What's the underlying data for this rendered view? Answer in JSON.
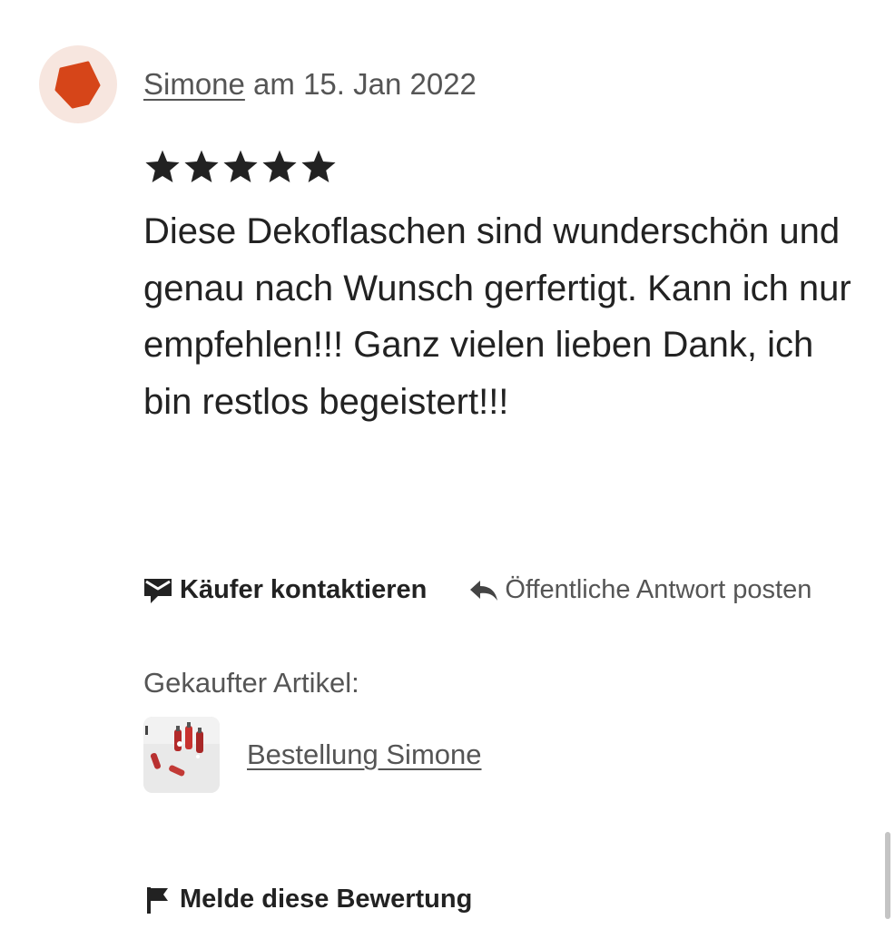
{
  "review": {
    "reviewer_name": "Simone",
    "date_text": " am 15. Jan 2022",
    "rating": 5,
    "rating_max": 5,
    "text": "Diese Dekoflaschen sind wunderschön und genau nach Wunsch gerfertigt. Kann ich nur empfehlen!!! Ganz vielen lieben Dank, ich bin restlos begeistert!!!"
  },
  "actions": {
    "contact_label": "Käufer kontaktieren",
    "reply_label": "Öffentliche Antwort posten",
    "contact_icon": "envelope-icon",
    "reply_icon": "reply-arrow-icon"
  },
  "purchased": {
    "label": "Gekaufter Artikel:",
    "item_link": "Bestellung Simone"
  },
  "report": {
    "label": "Melde diese Bewertung",
    "icon": "flag-icon"
  },
  "colors": {
    "avatar_bg": "#f7e6df",
    "avatar_shape": "#d64519",
    "text_primary": "#222222",
    "text_secondary": "#555555"
  }
}
